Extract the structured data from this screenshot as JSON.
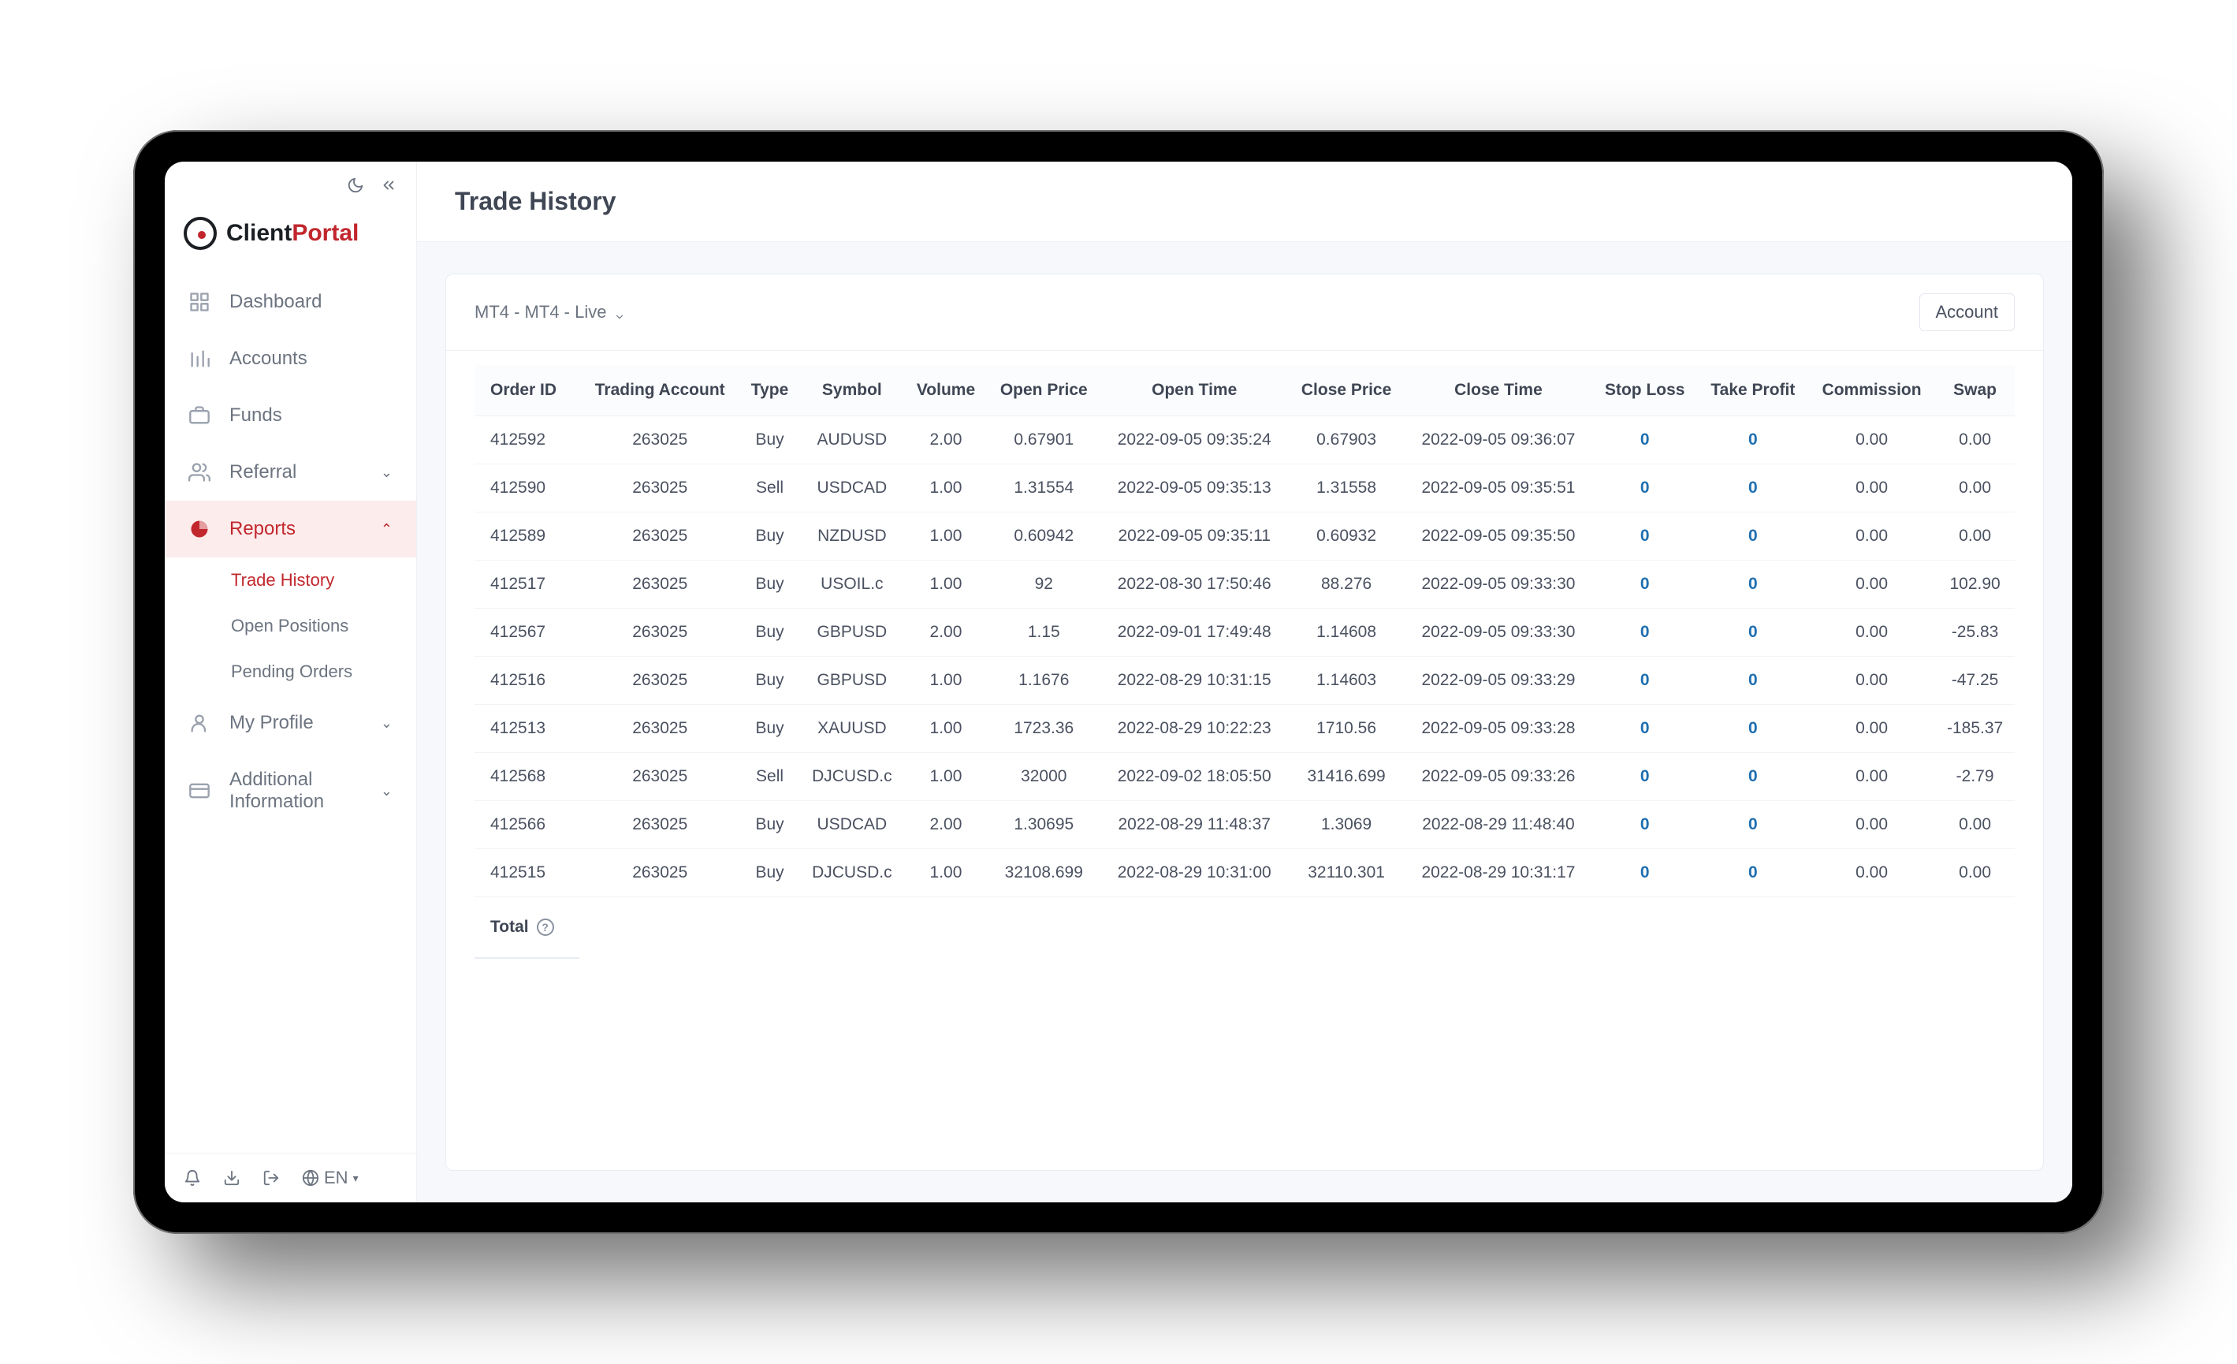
{
  "brand": {
    "part1": "Client",
    "part2": "Portal"
  },
  "page_title": "Trade History",
  "sidebar": {
    "items": [
      {
        "label": "Dashboard",
        "expandable": false
      },
      {
        "label": "Accounts",
        "expandable": false
      },
      {
        "label": "Funds",
        "expandable": false
      },
      {
        "label": "Referral",
        "expandable": true,
        "open": false
      },
      {
        "label": "Reports",
        "expandable": true,
        "open": true,
        "active": true,
        "children": [
          "Trade History",
          "Open Positions",
          "Pending Orders"
        ],
        "active_child": 0
      },
      {
        "label": "My Profile",
        "expandable": true,
        "open": false
      },
      {
        "label": "Additional Information",
        "expandable": true,
        "open": false
      }
    ],
    "bottom_lang": "EN"
  },
  "filter": {
    "account_selector": "MT4 - MT4 - Live",
    "account_button": "Account"
  },
  "table": {
    "columns": [
      "Order ID",
      "Trading Account",
      "Type",
      "Symbol",
      "Volume",
      "Open Price",
      "Open Time",
      "Close Price",
      "Close Time",
      "Stop Loss",
      "Take Profit",
      "Commission",
      "Swap"
    ],
    "rows": [
      [
        "412592",
        "263025",
        "Buy",
        "AUDUSD",
        "2.00",
        "0.67901",
        "2022-09-05 09:35:24",
        "0.67903",
        "2022-09-05 09:36:07",
        "0",
        "0",
        "0.00",
        "0.00"
      ],
      [
        "412590",
        "263025",
        "Sell",
        "USDCAD",
        "1.00",
        "1.31554",
        "2022-09-05 09:35:13",
        "1.31558",
        "2022-09-05 09:35:51",
        "0",
        "0",
        "0.00",
        "0.00"
      ],
      [
        "412589",
        "263025",
        "Buy",
        "NZDUSD",
        "1.00",
        "0.60942",
        "2022-09-05 09:35:11",
        "0.60932",
        "2022-09-05 09:35:50",
        "0",
        "0",
        "0.00",
        "0.00"
      ],
      [
        "412517",
        "263025",
        "Buy",
        "USOIL.c",
        "1.00",
        "92",
        "2022-08-30 17:50:46",
        "88.276",
        "2022-09-05 09:33:30",
        "0",
        "0",
        "0.00",
        "102.90"
      ],
      [
        "412567",
        "263025",
        "Buy",
        "GBPUSD",
        "2.00",
        "1.15",
        "2022-09-01 17:49:48",
        "1.14608",
        "2022-09-05 09:33:30",
        "0",
        "0",
        "0.00",
        "-25.83"
      ],
      [
        "412516",
        "263025",
        "Buy",
        "GBPUSD",
        "1.00",
        "1.1676",
        "2022-08-29 10:31:15",
        "1.14603",
        "2022-09-05 09:33:29",
        "0",
        "0",
        "0.00",
        "-47.25"
      ],
      [
        "412513",
        "263025",
        "Buy",
        "XAUUSD",
        "1.00",
        "1723.36",
        "2022-08-29 10:22:23",
        "1710.56",
        "2022-09-05 09:33:28",
        "0",
        "0",
        "0.00",
        "-185.37"
      ],
      [
        "412568",
        "263025",
        "Sell",
        "DJCUSD.c",
        "1.00",
        "32000",
        "2022-09-02 18:05:50",
        "31416.699",
        "2022-09-05 09:33:26",
        "0",
        "0",
        "0.00",
        "-2.79"
      ],
      [
        "412566",
        "263025",
        "Buy",
        "USDCAD",
        "2.00",
        "1.30695",
        "2022-08-29 11:48:37",
        "1.3069",
        "2022-08-29 11:48:40",
        "0",
        "0",
        "0.00",
        "0.00"
      ],
      [
        "412515",
        "263025",
        "Buy",
        "DJCUSD.c",
        "1.00",
        "32108.699",
        "2022-08-29 10:31:00",
        "32110.301",
        "2022-08-29 10:31:17",
        "0",
        "0",
        "0.00",
        "0.00"
      ]
    ],
    "total_label": "Total"
  }
}
